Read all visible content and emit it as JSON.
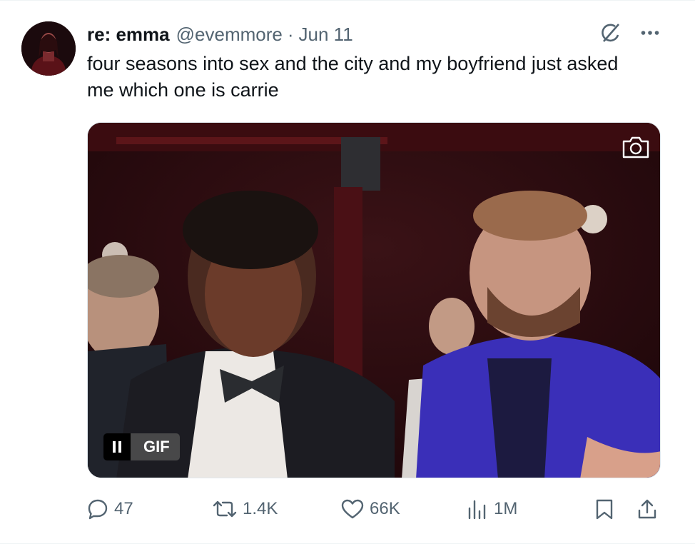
{
  "tweet": {
    "display_name": "re: emma",
    "handle": "@evemmore",
    "separator": "·",
    "date": "Jun 11",
    "text": "four seasons into sex and the city and my boyfriend just asked me which one is carrie"
  },
  "media": {
    "type": "gif",
    "badge_label": "GIF",
    "pause_icon": "pause-icon",
    "camera_icon": "camera-icon"
  },
  "actions": {
    "replies": "47",
    "reposts": "1.4K",
    "likes": "66K",
    "views": "1M"
  },
  "icons": {
    "grok": "grok-icon",
    "more": "more-dots-icon",
    "reply": "reply-bubble-icon",
    "repost": "repost-icon",
    "like": "heart-icon",
    "views": "views-chart-icon",
    "bookmark": "bookmark-icon",
    "share": "share-icon"
  },
  "colors": {
    "text_primary": "#0f1419",
    "text_secondary": "#536471",
    "border": "#eff3f4"
  }
}
